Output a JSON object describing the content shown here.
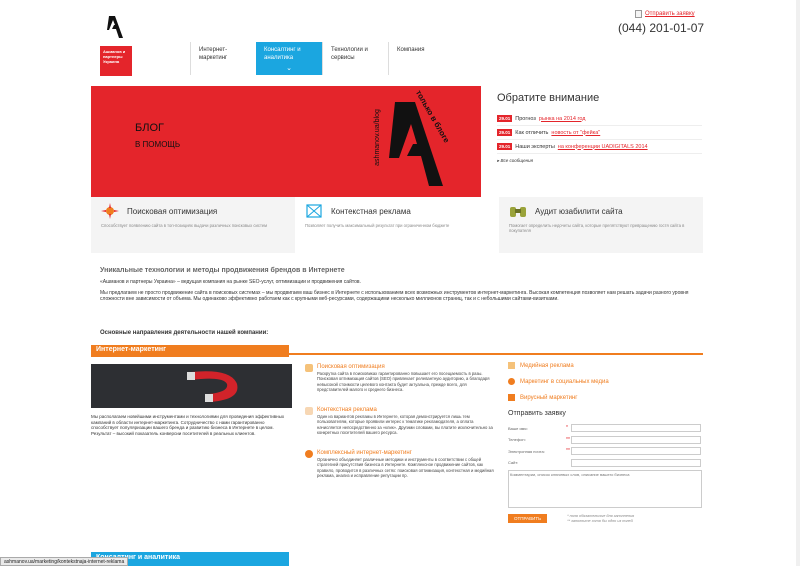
{
  "header": {
    "logo_text": "Ашманов и партнеры Украина",
    "order_link": "Отправить заявку",
    "phone": "(044) 201-01-07"
  },
  "nav": [
    {
      "label": "Интернет-маркетинг"
    },
    {
      "label": "Консалтинг и аналитика"
    },
    {
      "label": "Технологии и сервисы"
    },
    {
      "label": "Компания"
    }
  ],
  "banner": {
    "line1": "БЛОГ",
    "line2": "В ПОМОЩЬ",
    "url": "ashmanov.ua/blog",
    "side": "только в блоге"
  },
  "notice": {
    "title": "Обратите внимание",
    "news": [
      {
        "date": "29.01",
        "text": "Прогноз ",
        "link": "рынка на 2014 год"
      },
      {
        "date": "29.01",
        "text": "Как отличить ",
        "link": "новость от \"фейка\""
      },
      {
        "date": "29.01",
        "text": "Наши эксперты ",
        "link": "на конференции UADIGITALS 2014"
      }
    ],
    "all": "Все сообщения"
  },
  "features": [
    {
      "title": "Поисковая оптимизация",
      "desc": "Способствует появлению сайта в топ-позициях выдачи различных поисковых систем"
    },
    {
      "title": "Контекстная реклама",
      "desc": "Позволяет получить максимальный результат при ограниченном бюджете"
    },
    {
      "title": "Аудит юзабилити сайта",
      "desc": "Помогает определить недочеты сайта, которые препятствуют превращению гостя сайта в покупателя"
    }
  ],
  "intro": {
    "title": "Уникальные технологии и методы продвижения брендов в Интернете",
    "p1": "«Ашманов и партнеры Украина» – ведущая компания на рынке SEO-услуг, оптимизации и продвижения сайтов.",
    "p2": "Мы предлагаем не просто продвижение сайта в поисковых системах – мы продвигаем ваш бизнес в Интернете с использованием всех возможных инструментов интернет-маркетинга. Высокая компетенция позволяет нам решать задачи разного уровня сложности вне зависимости от объема. Мы одинаково эффективно работаем как с крупными веб-ресурсами, содержащими несколько миллионов страниц, так и с небольшими сайтами-визитками."
  },
  "directions_title": "Основные направления деятельности нашей компании:",
  "section_tab": "Интернет-маркетинг",
  "left_text": "Мы располагаем новейшими инструментами и технологиями для проведения эффективных кампаний в области интернет-маркетинга. Сотрудничество с нами гарантированно способствует популяризации вашего бренда и развитию бизнеса в Интернете в целом. Результат – высокий показатель конверсии посетителей в реальных клиентов.",
  "services": [
    {
      "title": "Поисковая оптимизация",
      "desc": "Раскрутка сайта в поисковиках гарантированно повышает его посещаемость в разы. Поисковая оптимизация сайтов (SEO) привлекает релевантную аудиторию, а благодаря невысокой стоимости целевого контакта будет актуальна, прежде всего, для представителей малого и среднего бизнеса."
    },
    {
      "title": "Контекстная реклама",
      "desc": "Один из вариантов рекламы в Интернете, которая демонстрируется лишь тем пользователям, которые проявили интерес к тематике рекламодателя, а оплата начисляется непосредственно за «клик». Другими словами, вы платите исключительно за конкретных посетителей вашего ресурса."
    },
    {
      "title": "Комплексный интернет-маркетинг",
      "desc": "Органично объединяет различные методики и инструменты в соответствии с общей стратегией присутствия бизнеса в Интернете. Комплексное продвижение сайтов, как правило, проводится в различных сетях: поисковая оптимизация, контекстная и медийная реклама, анализ и исправление репутации пр."
    }
  ],
  "right_links": [
    {
      "label": "Медийная реклама"
    },
    {
      "label": "Маркетинг в социальных медиа"
    },
    {
      "label": "Вирусный маркетинг"
    }
  ],
  "form": {
    "title": "Отправить заявку",
    "fields": [
      {
        "label": "Ваше имя:",
        "required": "*"
      },
      {
        "label": "Телефон:",
        "required": "**"
      },
      {
        "label": "Электронная почта:",
        "required": "**"
      },
      {
        "label": "Сайт:",
        "required": ""
      }
    ],
    "textarea_placeholder": "Комментарии, список ключевых слов, описание вашего бизнеса",
    "submit": "ОТПРАВИТЬ",
    "note1": "* поля обязательные для заполнения",
    "note2": "** заполните хотя бы одно из полей"
  },
  "bottom_tab": "Консалтинг и аналитика",
  "status_url": "ashmanov.ua/marketing/kontekstnaja-internet-reklama",
  "colors": {
    "red": "#e4252b",
    "blue": "#1ba6e0",
    "orange": "#f07d1f"
  }
}
